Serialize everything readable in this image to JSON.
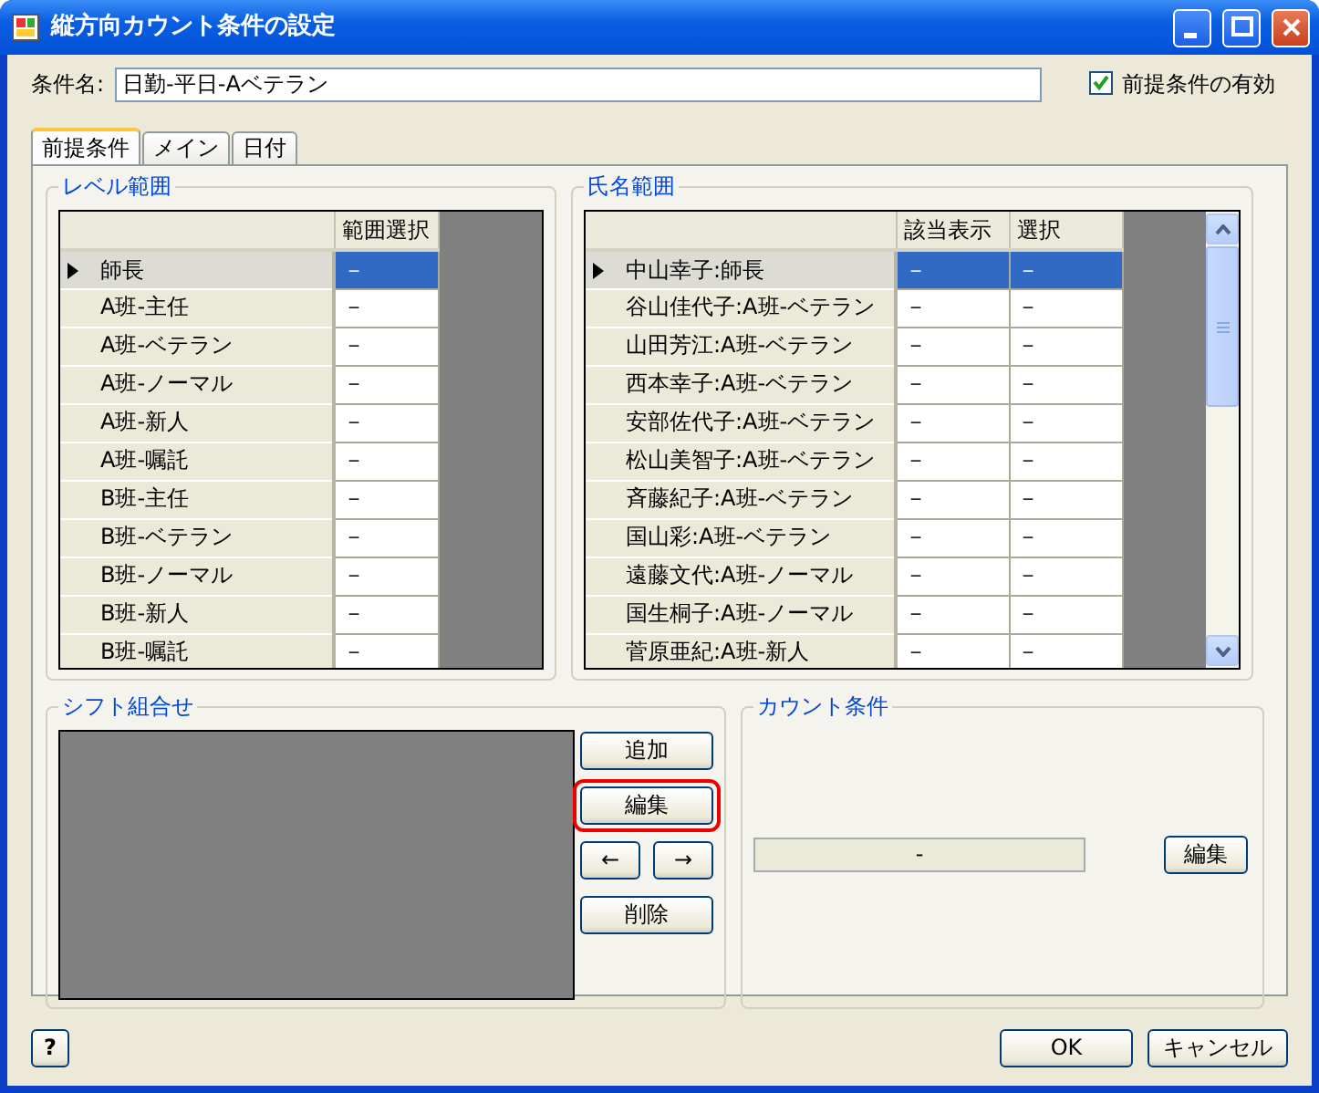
{
  "window": {
    "title": "縦方向カウント条件の設定"
  },
  "condition_name": {
    "label": "条件名:",
    "value": "日勤-平日-Aベテラン"
  },
  "prerequisite_enabled": {
    "label": "前提条件の有効",
    "checked": true
  },
  "tabs": [
    {
      "label": "前提条件",
      "selected": true
    },
    {
      "label": "メイン",
      "selected": false
    },
    {
      "label": "日付",
      "selected": false
    }
  ],
  "level_range": {
    "title": "レベル範囲",
    "columns": [
      "範囲選択"
    ],
    "rows": [
      {
        "label": "師長",
        "cells": [
          "－"
        ],
        "selected": true
      },
      {
        "label": "A班-主任",
        "cells": [
          "－"
        ],
        "selected": false
      },
      {
        "label": "A班-ベテラン",
        "cells": [
          "－"
        ],
        "selected": false
      },
      {
        "label": "A班-ノーマル",
        "cells": [
          "－"
        ],
        "selected": false
      },
      {
        "label": "A班-新人",
        "cells": [
          "－"
        ],
        "selected": false
      },
      {
        "label": "A班-嘱託",
        "cells": [
          "－"
        ],
        "selected": false
      },
      {
        "label": "B班-主任",
        "cells": [
          "－"
        ],
        "selected": false
      },
      {
        "label": "B班-ベテラン",
        "cells": [
          "－"
        ],
        "selected": false
      },
      {
        "label": "B班-ノーマル",
        "cells": [
          "－"
        ],
        "selected": false
      },
      {
        "label": "B班-新人",
        "cells": [
          "－"
        ],
        "selected": false
      },
      {
        "label": "B班-嘱託",
        "cells": [
          "－"
        ],
        "selected": false
      }
    ]
  },
  "name_range": {
    "title": "氏名範囲",
    "columns": [
      "該当表示",
      "選択"
    ],
    "rows": [
      {
        "label": "中山幸子:師長",
        "cells": [
          "－",
          "－"
        ],
        "selected": true
      },
      {
        "label": "谷山佳代子:A班-ベテラン",
        "cells": [
          "－",
          "－"
        ],
        "selected": false
      },
      {
        "label": "山田芳江:A班-ベテラン",
        "cells": [
          "－",
          "－"
        ],
        "selected": false
      },
      {
        "label": "西本幸子:A班-ベテラン",
        "cells": [
          "－",
          "－"
        ],
        "selected": false
      },
      {
        "label": "安部佐代子:A班-ベテラン",
        "cells": [
          "－",
          "－"
        ],
        "selected": false
      },
      {
        "label": "松山美智子:A班-ベテラン",
        "cells": [
          "－",
          "－"
        ],
        "selected": false
      },
      {
        "label": "斉藤紀子:A班-ベテラン",
        "cells": [
          "－",
          "－"
        ],
        "selected": false
      },
      {
        "label": "国山彩:A班-ベテラン",
        "cells": [
          "－",
          "－"
        ],
        "selected": false
      },
      {
        "label": "遠藤文代:A班-ノーマル",
        "cells": [
          "－",
          "－"
        ],
        "selected": false
      },
      {
        "label": "国生桐子:A班-ノーマル",
        "cells": [
          "－",
          "－"
        ],
        "selected": false
      },
      {
        "label": "菅原亜紀:A班-新人",
        "cells": [
          "－",
          "－"
        ],
        "selected": false
      }
    ]
  },
  "shift_combination": {
    "title": "シフト組合せ",
    "buttons": [
      {
        "label": "追加",
        "kind": "wide",
        "highlighted": false
      },
      {
        "label": "編集",
        "kind": "wide",
        "highlighted": true
      },
      {
        "label": "←",
        "kind": "half",
        "highlighted": false
      },
      {
        "label": "→",
        "kind": "half",
        "highlighted": false
      },
      {
        "label": "削除",
        "kind": "wide",
        "highlighted": false
      }
    ]
  },
  "count_condition": {
    "title": "カウント条件",
    "value": "-",
    "button": "編集"
  },
  "footer": {
    "help": "?",
    "buttons": [
      "OK",
      "キャンセル"
    ]
  }
}
